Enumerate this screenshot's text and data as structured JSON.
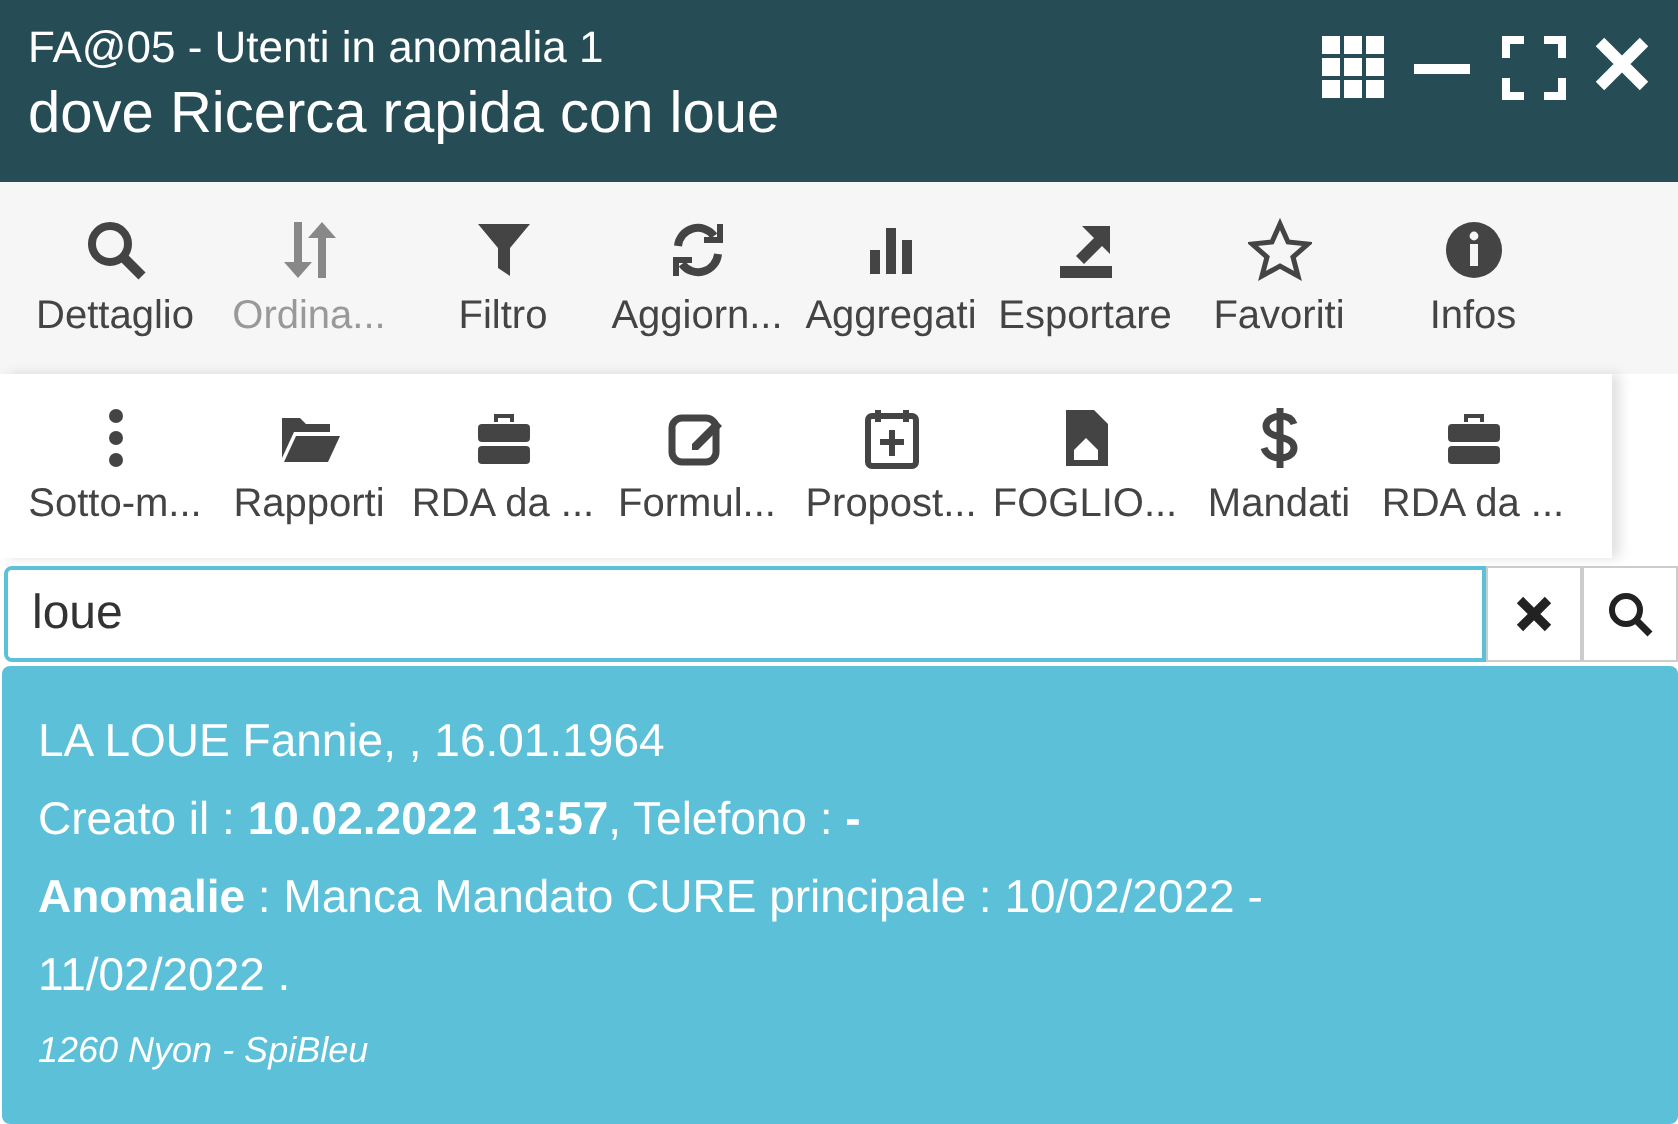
{
  "window": {
    "title": "FA@05 - Utenti in anomalia 1",
    "subtitle": "dove Ricerca rapida con loue"
  },
  "toolbar_rows": [
    [
      {
        "label": "Dettaglio",
        "disabled": false
      },
      {
        "label": "Ordina...",
        "disabled": true
      },
      {
        "label": "Filtro",
        "disabled": false
      },
      {
        "label": "Aggiorn...",
        "disabled": false
      },
      {
        "label": "Aggregati",
        "disabled": false
      },
      {
        "label": "Esportare",
        "disabled": false
      },
      {
        "label": "Favoriti",
        "disabled": false
      },
      {
        "label": "Infos",
        "disabled": false
      }
    ],
    [
      {
        "label": "Sotto-m...",
        "disabled": false
      },
      {
        "label": "Rapporti",
        "disabled": false
      },
      {
        "label": "RDA da ...",
        "disabled": false
      },
      {
        "label": "Formul...",
        "disabled": false
      },
      {
        "label": "Propost...",
        "disabled": false
      },
      {
        "label": "FOGLIO...",
        "disabled": false
      },
      {
        "label": "Mandati",
        "disabled": false
      },
      {
        "label": "RDA da ...",
        "disabled": false
      }
    ]
  ],
  "search": {
    "value": "loue"
  },
  "results": [
    {
      "selected": true,
      "lines": [
        "LA LOUE Fannie, , 16.01.1964",
        "Creato il : **10.02.2022 13:57**, Telefono : **-**",
        "**Anomalie** : Manca Mandato CURE principale : 10/02/2022 - 11/02/2022 ."
      ],
      "footer": "1260 Nyon - SpiBleu"
    }
  ]
}
